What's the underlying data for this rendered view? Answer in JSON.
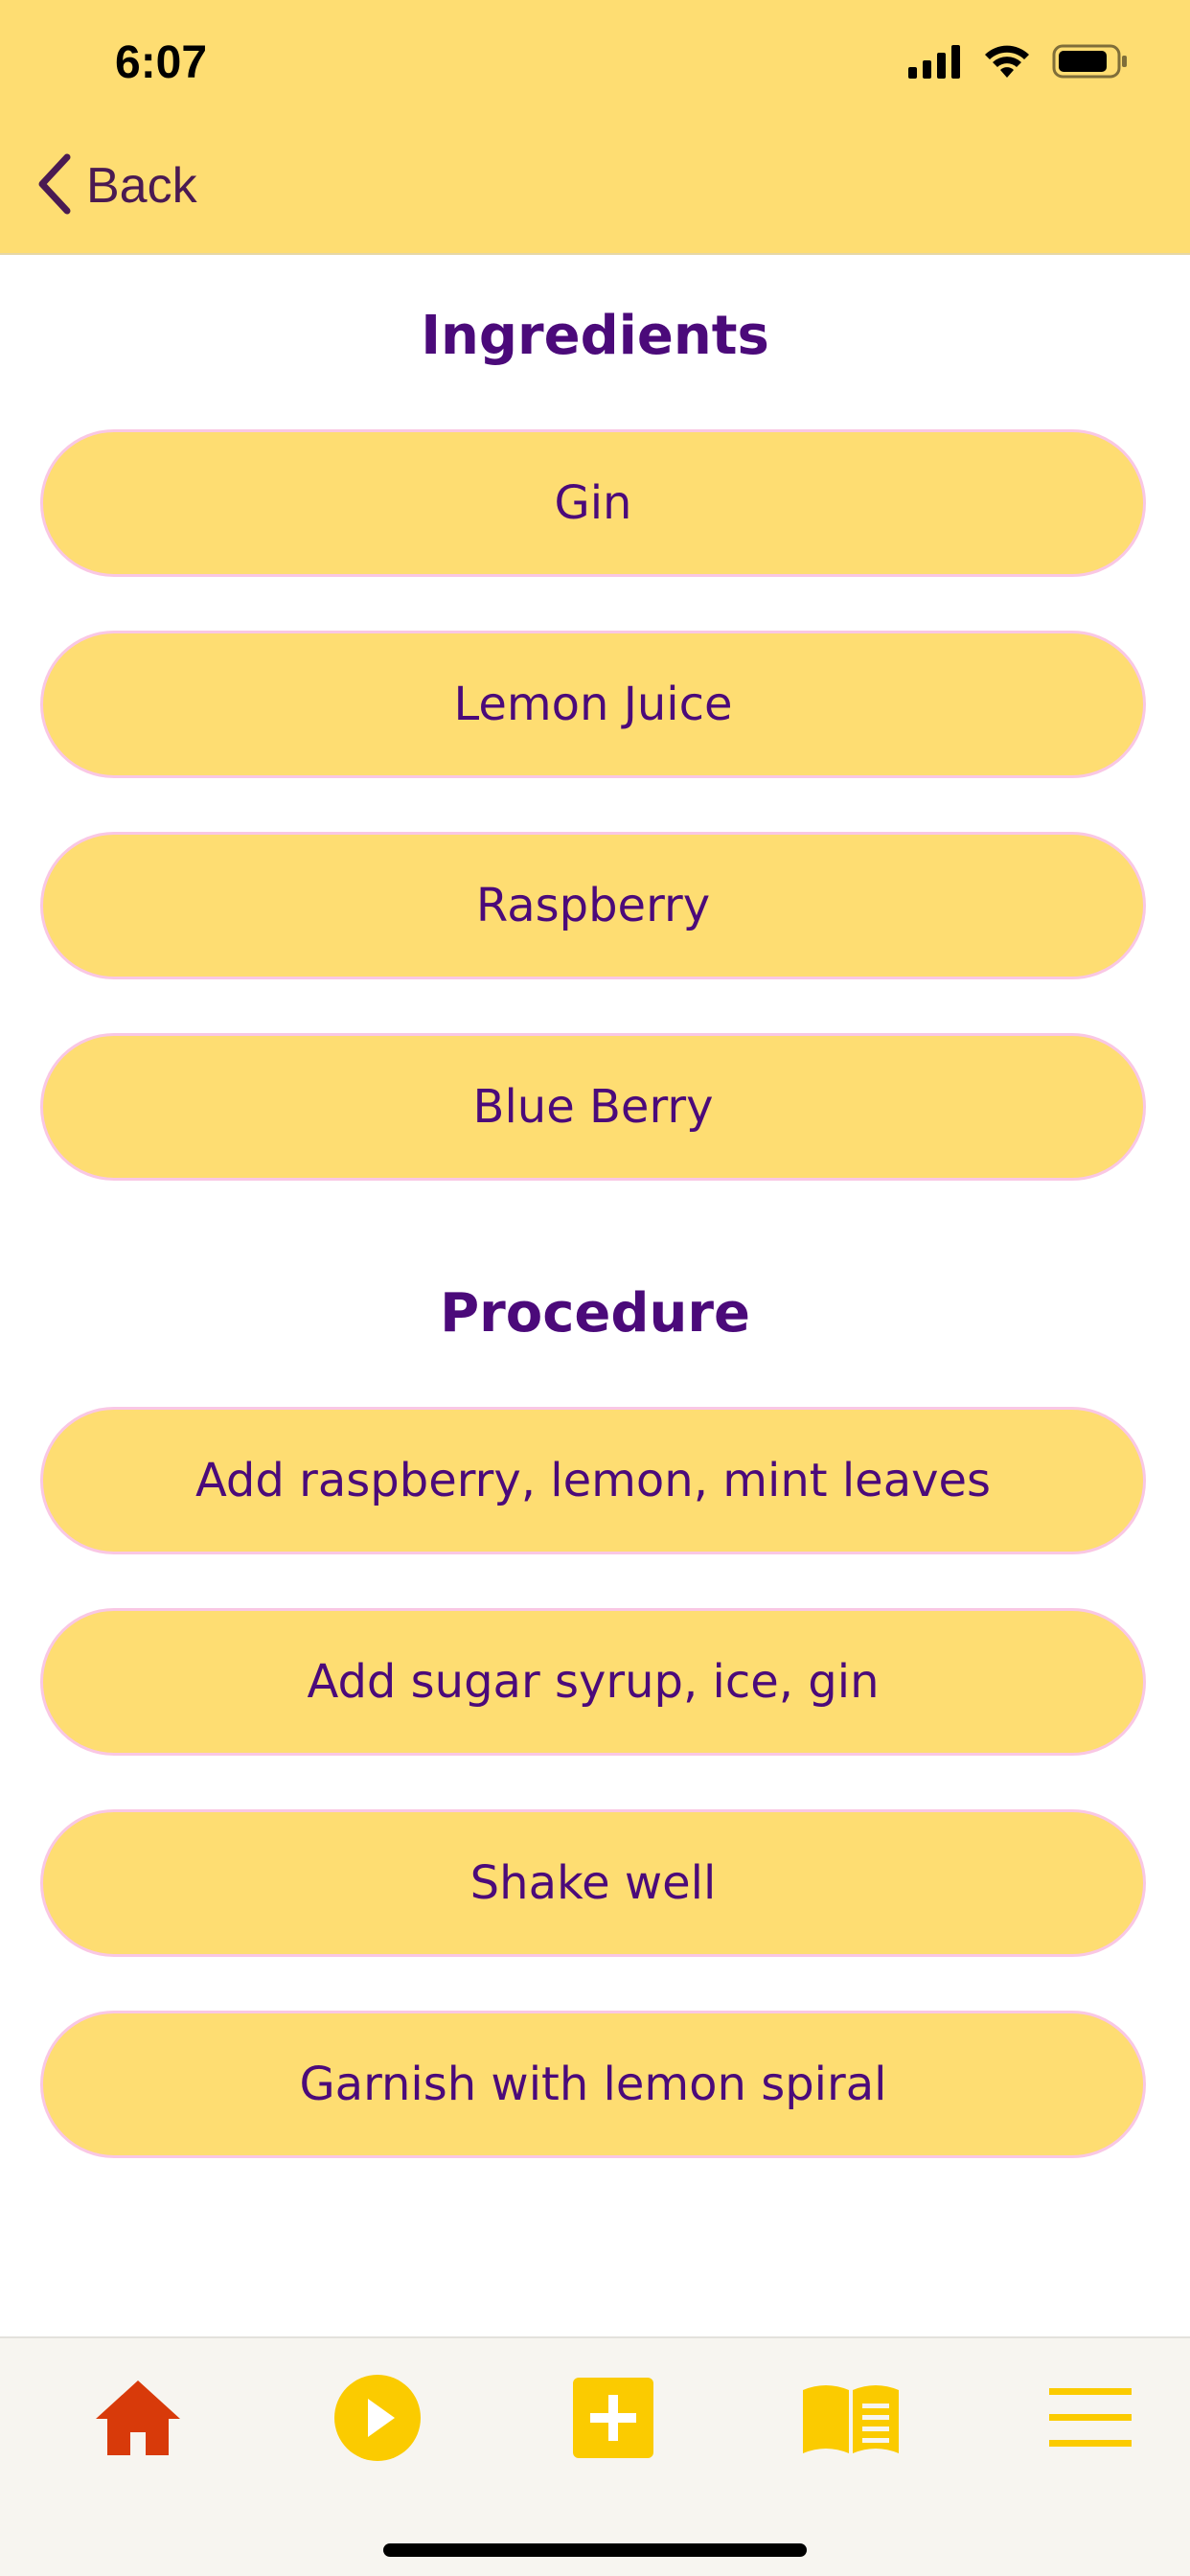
{
  "status_bar": {
    "time": "6:07"
  },
  "nav": {
    "back_label": "Back"
  },
  "ingredients": {
    "title": "Ingredients",
    "items": [
      "Gin",
      "Lemon Juice",
      "Raspberry",
      "Blue Berry"
    ]
  },
  "procedure": {
    "title": "Procedure",
    "steps": [
      "Add raspberry, lemon, mint leaves",
      "Add sugar syrup, ice, gin",
      "Shake well",
      "Garnish with lemon spiral"
    ]
  },
  "tabbar": {
    "items": [
      "home-icon",
      "play-icon",
      "add-icon",
      "book-icon",
      "menu-icon"
    ]
  },
  "colors": {
    "header_bg": "#FEDD72",
    "pill_bg": "#FEDD72",
    "pill_border": "#F9C7E4",
    "text_purple": "#4B0A7A",
    "home_active": "#D83A0A",
    "tab_icon": "#FBCB00"
  }
}
